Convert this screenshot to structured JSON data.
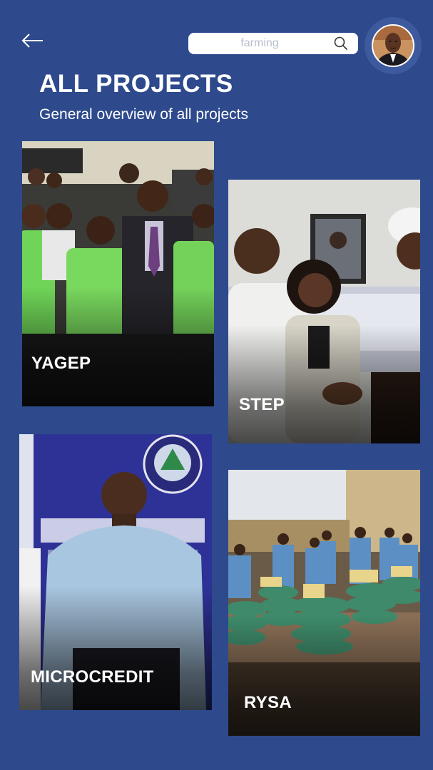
{
  "header": {
    "back_label": "Back",
    "search": {
      "placeholder": "farming",
      "value": ""
    }
  },
  "page": {
    "title": "ALL PROJECTS",
    "subtitle": "General overview of all projects"
  },
  "projects": [
    {
      "label": "YAGEP"
    },
    {
      "label": "STEP"
    },
    {
      "label": "MICROCREDIT"
    },
    {
      "label": "RYSA"
    }
  ],
  "colors": {
    "background": "#2e4a8d",
    "avatar_ring": "#3d5a9f",
    "text": "#ffffff",
    "search_placeholder": "#b8bec8"
  },
  "icons": {
    "back": "arrow-left-icon",
    "search": "search-icon"
  }
}
